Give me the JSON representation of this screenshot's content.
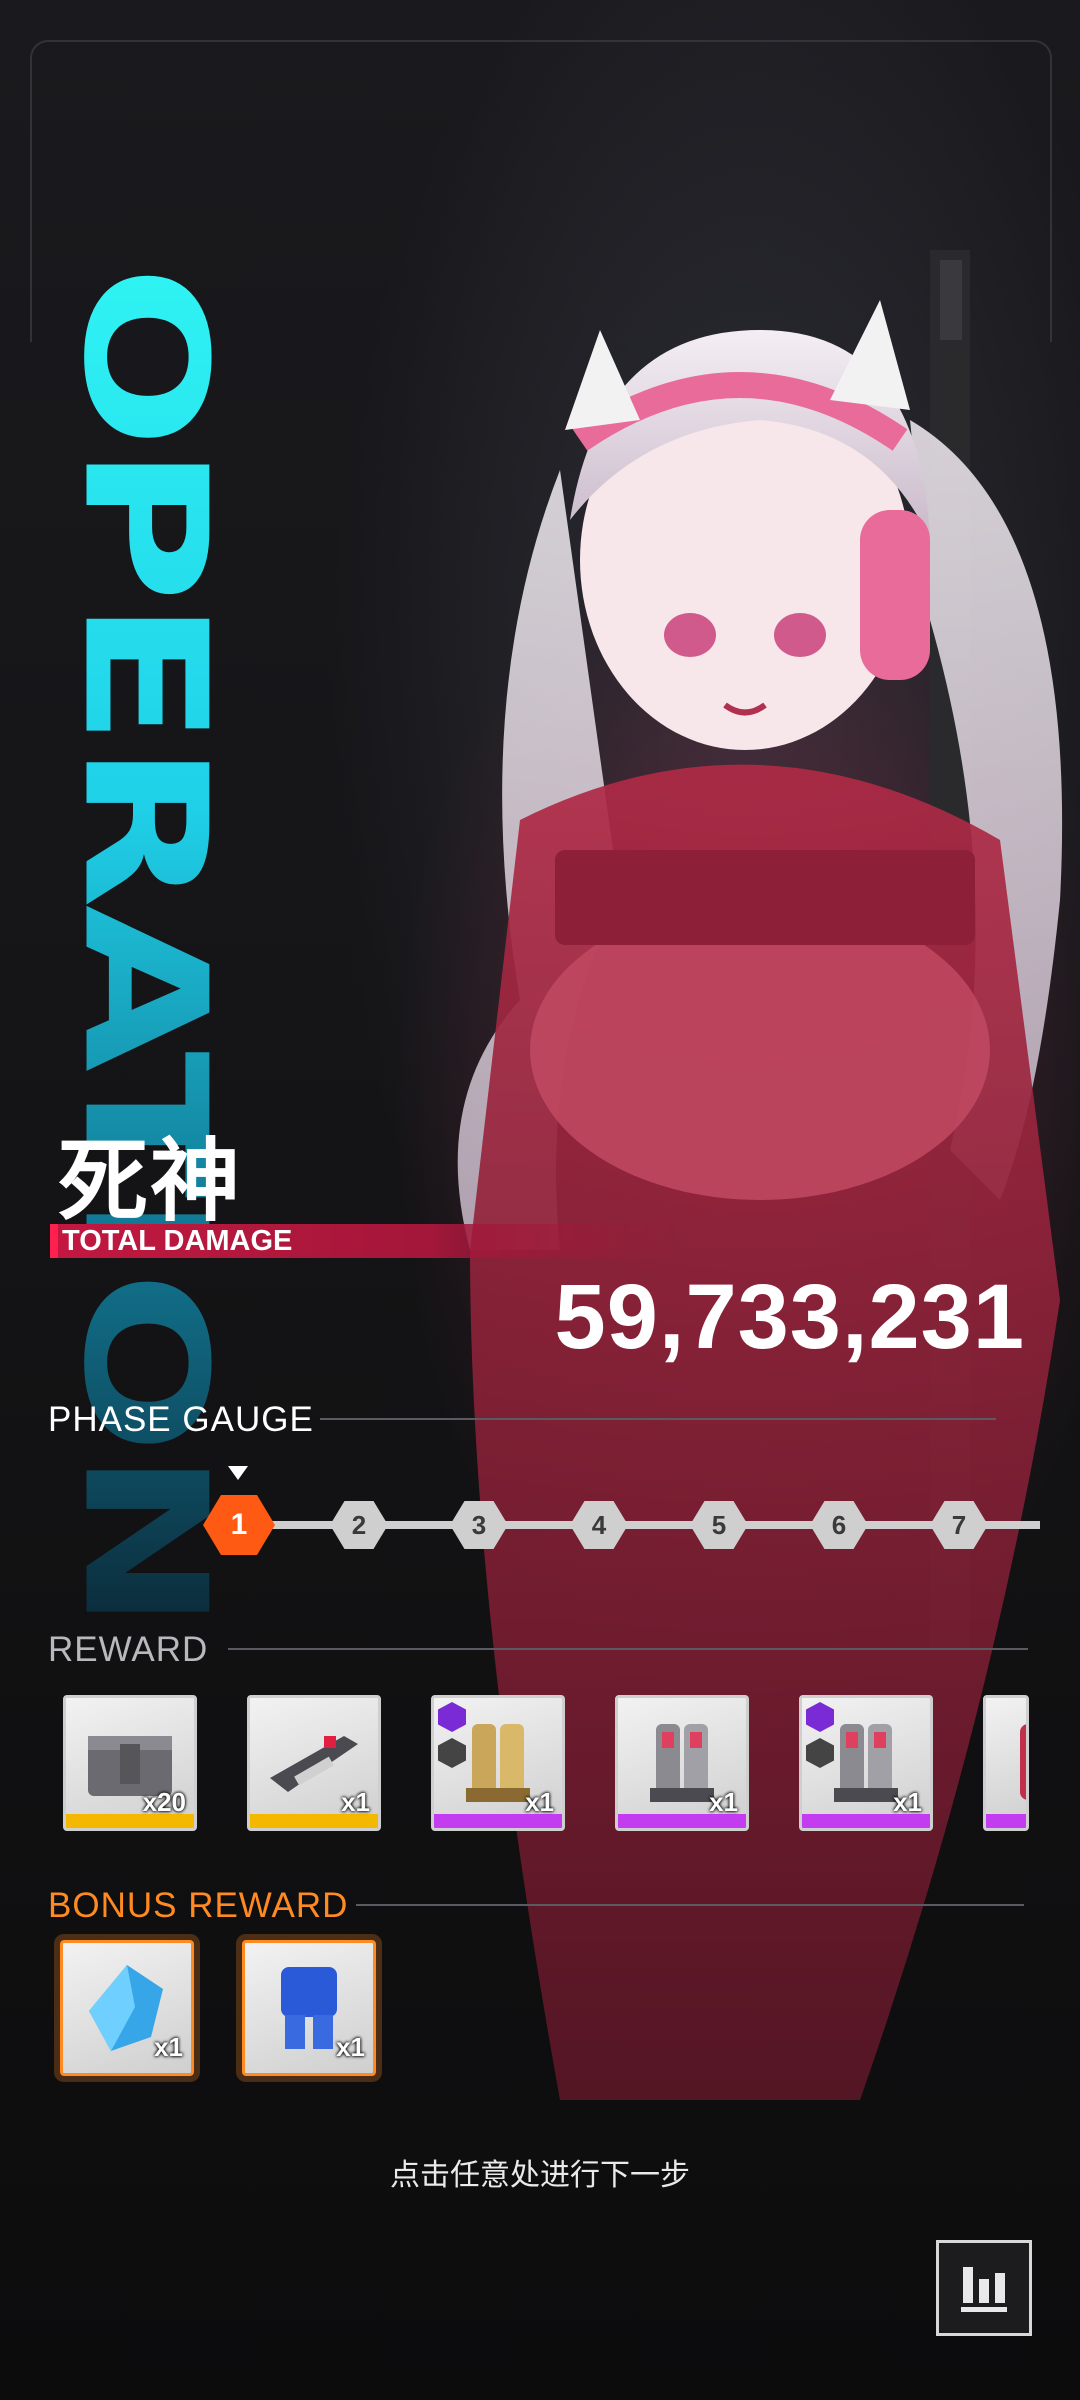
{
  "header": {
    "operation_title": "OPERATION"
  },
  "boss": {
    "name": "死神"
  },
  "damage": {
    "label": "TOTAL DAMAGE",
    "value": "59,733,231"
  },
  "phase_gauge": {
    "title": "PHASE GAUGE",
    "current_phase": "1",
    "phases": [
      "1",
      "2",
      "3",
      "4",
      "5",
      "6",
      "7"
    ]
  },
  "reward": {
    "title": "REWARD",
    "items": [
      {
        "icon": "supply-crate-icon",
        "quantity": "x20",
        "rarity_color": "#f5b800"
      },
      {
        "icon": "rifle-part-icon",
        "quantity": "x1",
        "rarity_color": "#f5b800"
      },
      {
        "icon": "gold-boots-gear-icon",
        "quantity": "x1",
        "rarity_color": "#c43cf0",
        "tier_badge": "ii"
      },
      {
        "icon": "grey-boots-gear-icon",
        "quantity": "x1",
        "rarity_color": "#c43cf0"
      },
      {
        "icon": "grey-boots-gear-icon",
        "quantity": "x1",
        "rarity_color": "#c43cf0",
        "tier_badge": "ii"
      },
      {
        "icon": "red-gear-icon",
        "quantity": "",
        "rarity_color": "#c43cf0"
      }
    ]
  },
  "bonus_reward": {
    "title": "BONUS REWARD",
    "items": [
      {
        "icon": "blue-crystal-icon",
        "quantity": "x1",
        "border_color": "#ff8a22"
      },
      {
        "icon": "blue-armor-gear-icon",
        "quantity": "x1",
        "border_color": "#ff8a22"
      }
    ]
  },
  "hint": "点击任意处进行下一步",
  "colors": {
    "accent_cyan": "#2ff3f3",
    "accent_orange": "#ff5a14",
    "bonus_orange": "#ff8a22",
    "damage_red": "#c21840",
    "epic_purple": "#c43cf0",
    "rare_yellow": "#f5b800"
  }
}
